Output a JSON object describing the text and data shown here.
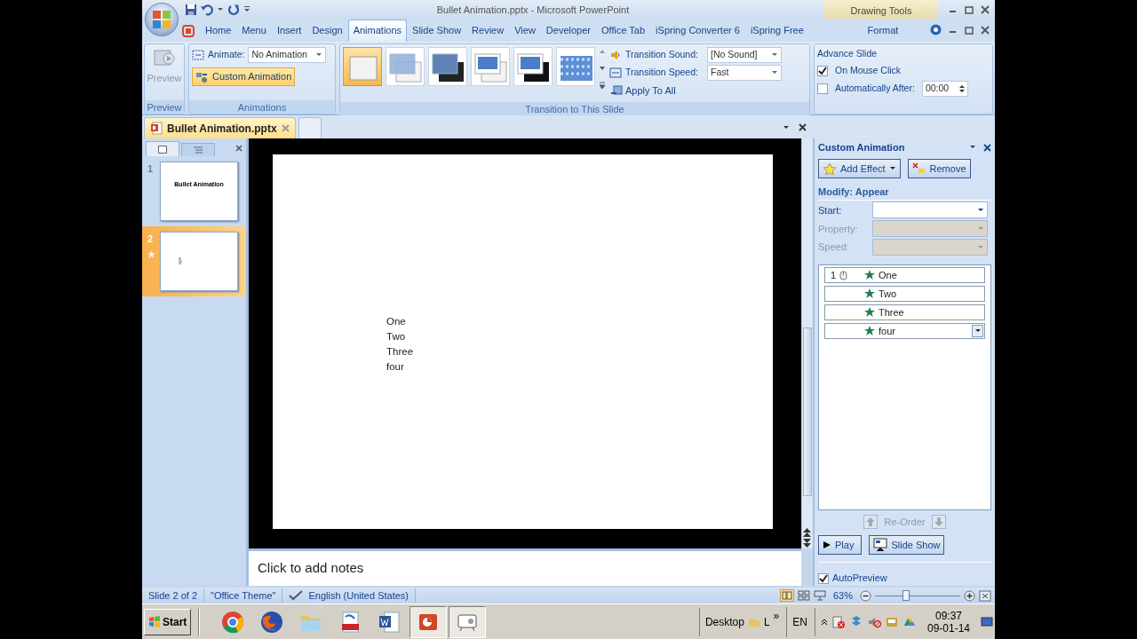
{
  "window": {
    "title": "Bullet Animation.pptx - Microsoft PowerPoint",
    "context_header": "Drawing Tools"
  },
  "ribbon_tabs": [
    {
      "label": "Home",
      "selected": false,
      "kind": "normal"
    },
    {
      "label": "Menu",
      "selected": false,
      "kind": "normal"
    },
    {
      "label": "Insert",
      "selected": false,
      "kind": "normal"
    },
    {
      "label": "Design",
      "selected": false,
      "kind": "normal"
    },
    {
      "label": "Animations",
      "selected": true,
      "kind": "normal"
    },
    {
      "label": "Slide Show",
      "selected": false,
      "kind": "normal"
    },
    {
      "label": "Review",
      "selected": false,
      "kind": "normal"
    },
    {
      "label": "View",
      "selected": false,
      "kind": "normal"
    },
    {
      "label": "Developer",
      "selected": false,
      "kind": "normal"
    },
    {
      "label": "Office Tab",
      "selected": false,
      "kind": "normal"
    },
    {
      "label": "iSpring Converter 6",
      "selected": false,
      "kind": "normal"
    },
    {
      "label": "iSpring Free",
      "selected": false,
      "kind": "normal"
    },
    {
      "label": "Format",
      "selected": false,
      "kind": "contextual"
    }
  ],
  "ribbon": {
    "preview_group": {
      "button": "Preview",
      "disabled": true,
      "label": "Preview"
    },
    "animations_group": {
      "animate_label": "Animate:",
      "animate_value": "No Animation",
      "custom_button": "Custom Animation",
      "label": "Animations"
    },
    "transition_group": {
      "thumbnails": [
        {
          "kind": "none",
          "selected": true
        },
        {
          "kind": "fade",
          "selected": false
        },
        {
          "kind": "fade-black",
          "selected": false
        },
        {
          "kind": "cut",
          "selected": false
        },
        {
          "kind": "cut-black",
          "selected": false
        },
        {
          "kind": "dissolve",
          "selected": false
        }
      ],
      "sound_label": "Transition Sound:",
      "sound_value": "[No Sound]",
      "speed_label": "Transition Speed:",
      "speed_value": "Fast",
      "apply_button": "Apply To All",
      "label": "Transition to This Slide"
    },
    "advance_group": {
      "title": "Advance Slide",
      "on_click": {
        "label": "On Mouse Click",
        "checked": true
      },
      "auto": {
        "label": "Automatically After:",
        "checked": false,
        "value": "00:00"
      }
    }
  },
  "document_tabs": [
    {
      "label": "Bullet Animation.pptx",
      "selected": true
    }
  ],
  "slides": [
    {
      "number": "1",
      "title": "Bullet Animation",
      "selected": false,
      "animated": false
    },
    {
      "number": "2",
      "selected": true,
      "animated": true
    }
  ],
  "slide": {
    "lines": [
      "One",
      "Two",
      "Three",
      "four"
    ]
  },
  "notes": {
    "placeholder": "Click to add notes"
  },
  "task_pane": {
    "title": "Custom Animation",
    "add_effect": "Add Effect",
    "remove": "Remove",
    "modify": "Modify: Appear",
    "fields": [
      {
        "label": "Start:",
        "disabled": false
      },
      {
        "label": "Property:",
        "disabled": true
      },
      {
        "label": "Speed:",
        "disabled": true
      }
    ],
    "effects": [
      {
        "order": "1",
        "label": "One",
        "selected": false
      },
      {
        "label": "Two",
        "selected": false
      },
      {
        "label": "Three",
        "selected": false
      },
      {
        "label": "four",
        "selected": true
      }
    ],
    "reorder": "Re-Order",
    "play": "Play",
    "slide_show": "Slide Show",
    "autopreview": {
      "label": "AutoPreview",
      "checked": true
    }
  },
  "status_bar": {
    "slide": "Slide 2 of 2",
    "theme": "\"Office Theme\"",
    "language": "English (United States)",
    "zoom": "63%",
    "zoom_slider": {
      "level": 0.35
    }
  },
  "taskbar": {
    "start": "Start",
    "apps": [
      {
        "kind": "chrome",
        "active": false
      },
      {
        "kind": "firefox",
        "active": false
      },
      {
        "kind": "folder",
        "active": false
      },
      {
        "kind": "pdf",
        "active": false
      },
      {
        "kind": "word",
        "active": false
      },
      {
        "kind": "powerpoint",
        "active": true
      },
      {
        "kind": "projector",
        "active": true
      }
    ],
    "desktop": "Desktop",
    "toolbar_label": "L",
    "more": "»",
    "language": "EN",
    "time": "09:37",
    "date": "09-01-14"
  }
}
